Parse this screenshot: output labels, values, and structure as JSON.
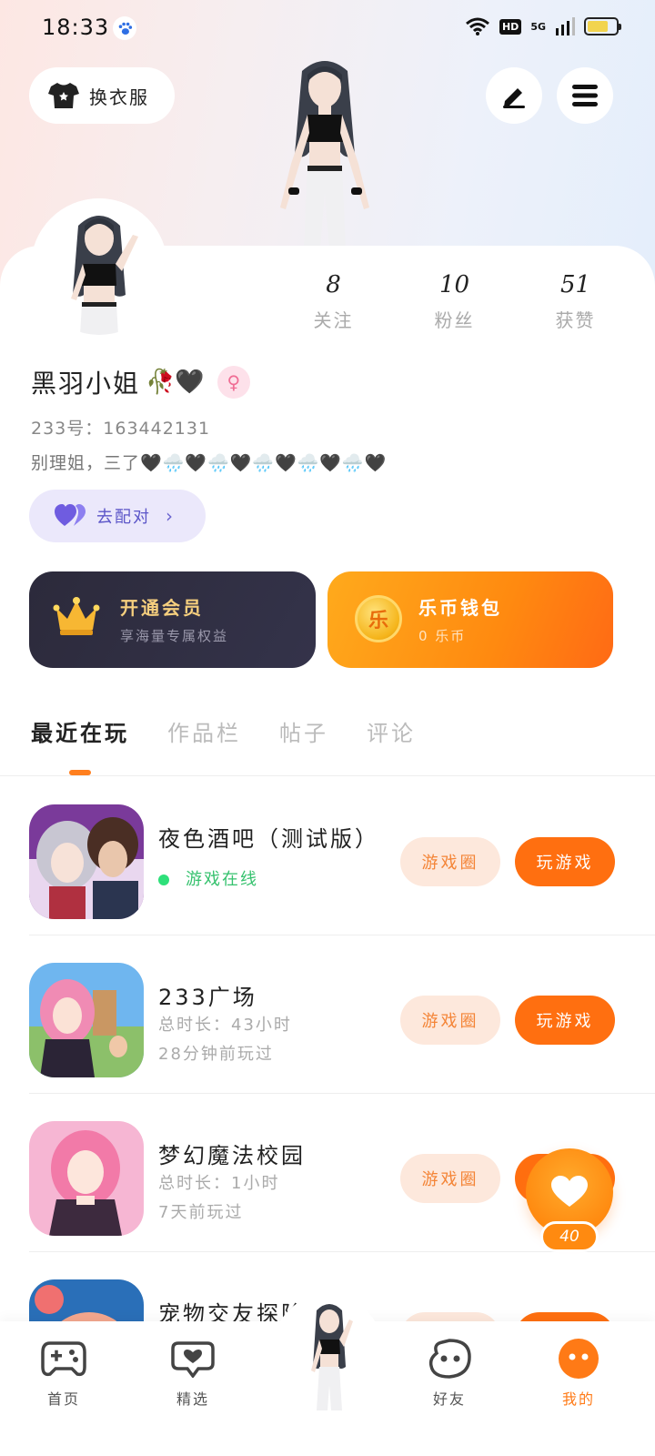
{
  "status_bar": {
    "time": "18:33",
    "hd": "HD",
    "network": "5G"
  },
  "header": {
    "outfit_label": "换衣服"
  },
  "profile": {
    "stats": [
      {
        "value": "8",
        "label": "关注"
      },
      {
        "value": "10",
        "label": "粉丝"
      },
      {
        "value": "51",
        "label": "获赞"
      }
    ],
    "name": "黑羽小姐",
    "name_emoji": "🥀🖤",
    "gender_symbol": "♀",
    "uid": "233号：163442131",
    "bio": "别理姐，三了🖤🌧️🖤🌧️🖤🌧️🖤🌧️🖤🌧️🖤",
    "match_label": "去配对"
  },
  "cards": {
    "vip": {
      "title": "开通会员",
      "subtitle": "享海量专属权益"
    },
    "wallet": {
      "title": "乐币钱包",
      "subtitle": "0 乐币",
      "coin_glyph": "乐"
    }
  },
  "tabs": [
    {
      "label": "最近在玩",
      "active": true
    },
    {
      "label": "作品栏"
    },
    {
      "label": "帖子"
    },
    {
      "label": "评论"
    }
  ],
  "games": [
    {
      "name": "夜色酒吧（测试版）",
      "online": "游戏在线",
      "circle_label": "游戏圈",
      "play_label": "玩游戏"
    },
    {
      "name": "233广场",
      "duration": "总时长：43小时",
      "last_played": "28分钟前玩过",
      "circle_label": "游戏圈",
      "play_label": "玩游戏"
    },
    {
      "name": "梦幻魔法校园",
      "duration": "总时长：1小时",
      "last_played": "7天前玩过",
      "circle_label": "游戏圈",
      "play_label": "玩游戏"
    },
    {
      "name": "宠物交友探险",
      "circle_label": "游戏圈",
      "play_label": "玩游戏"
    }
  ],
  "floating_like": {
    "count": "40"
  },
  "bottom_nav": [
    {
      "label": "首页",
      "icon": "gamepad-icon"
    },
    {
      "label": "精选",
      "icon": "heart-chat-icon"
    },
    {
      "label": "",
      "icon": "avatar-icon"
    },
    {
      "label": "好友",
      "icon": "friend-face-icon"
    },
    {
      "label": "我的",
      "icon": "me-face-icon",
      "active": true
    }
  ],
  "colors": {
    "accent": "#ff7a16",
    "play": "#ff6f10",
    "match": "#5b55c8"
  }
}
